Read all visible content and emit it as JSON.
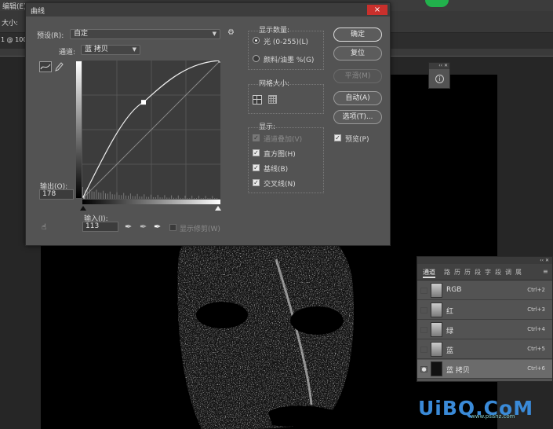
{
  "menubar": {
    "items": [
      "编辑(E)"
    ]
  },
  "optionsbar": {
    "label": "大小:",
    "tab_text": "1 @ 100"
  },
  "dialog": {
    "title": "曲线",
    "close_glyph": "×",
    "preset_label": "预设(R):",
    "preset_value": "自定",
    "channel_label": "通道:",
    "channel_value": "蓝 拷贝",
    "output_label": "输出(O):",
    "output_value": "178",
    "input_label": "输入(I):",
    "input_value": "113",
    "show_clipping_label": "显示修剪(W)",
    "show_amount": {
      "heading": "显示数量:",
      "light_label": "光 (0-255)(L)",
      "pigment_label": "颜料/油墨 %(G)"
    },
    "grid_size": {
      "heading": "网格大小:"
    },
    "show": {
      "heading": "显示:",
      "channel_overlays": "通道叠加(V)",
      "histogram": "直方图(H)",
      "baseline": "基线(B)",
      "intersection": "交叉线(N)"
    },
    "buttons": {
      "ok": "确定",
      "reset": "复位",
      "smooth": "平滑(M)",
      "auto": "自动(A)",
      "options": "选项(T)..."
    },
    "preview_label": "预览(P)",
    "curve": {
      "input": 113,
      "output": 178
    }
  },
  "channels_panel": {
    "collapse_glyph": "‹‹ ✕",
    "active_tab": "通道",
    "other_tabs": [
      "路",
      "历",
      "历",
      "段",
      "字",
      "段",
      "调",
      "属"
    ],
    "menu_glyph": "≡",
    "rows": [
      {
        "name": "RGB",
        "shortcut": "Ctrl+2",
        "eye": ""
      },
      {
        "name": "红",
        "shortcut": "Ctrl+3",
        "eye": ""
      },
      {
        "name": "绿",
        "shortcut": "Ctrl+4",
        "eye": ""
      },
      {
        "name": "蓝",
        "shortcut": "Ctrl+5",
        "eye": ""
      },
      {
        "name": "蓝 拷贝",
        "shortcut": "Ctrl+6",
        "eye": "●"
      }
    ]
  },
  "info_panel": {
    "collapse_glyph": "‹‹ ✕",
    "icon_glyph": "i"
  },
  "watermark": {
    "text": "UiBQ.CoM",
    "sub": "www.psahz.com"
  }
}
